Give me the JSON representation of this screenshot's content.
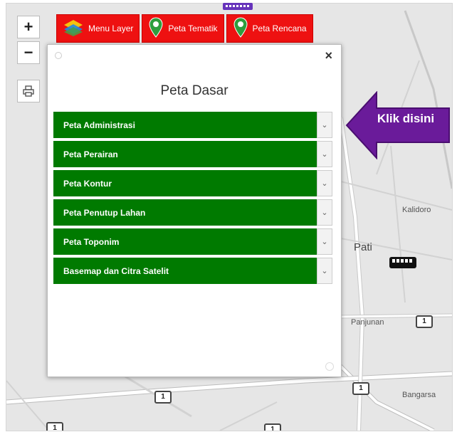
{
  "map": {
    "labels": {
      "city": "Pati",
      "kaliori": "Kalidoro",
      "panjunan": "Panjunan",
      "bargarsa": "Bangarsa"
    },
    "road_shields": [
      "1",
      "1",
      "1",
      "1",
      "1"
    ],
    "colors": {
      "background": "#e6e6e6",
      "road": "#ffffff",
      "road_outline": "#bfbfbf"
    }
  },
  "controls": {
    "zoom_in": "+",
    "zoom_out": "−",
    "print_icon": "printer-icon"
  },
  "top_menu": [
    {
      "label": "Menu Layer",
      "icon": "layers-icon"
    },
    {
      "label": "Peta Tematik",
      "icon": "map-pin-icon"
    },
    {
      "label": "Peta Rencana",
      "icon": "map-pin-icon"
    }
  ],
  "panel": {
    "title": "Peta Dasar",
    "close": "×",
    "layers": [
      "Peta Administrasi",
      "Peta Perairan",
      "Peta Kontur",
      "Peta Penutup Lahan",
      "Peta Toponim",
      "Basemap dan Citra Satelit"
    ]
  },
  "callout": {
    "text": "Klik disini",
    "color": "#6a1b9a"
  },
  "colors": {
    "menu_red": "#ee1111",
    "layer_green": "#007a00"
  }
}
